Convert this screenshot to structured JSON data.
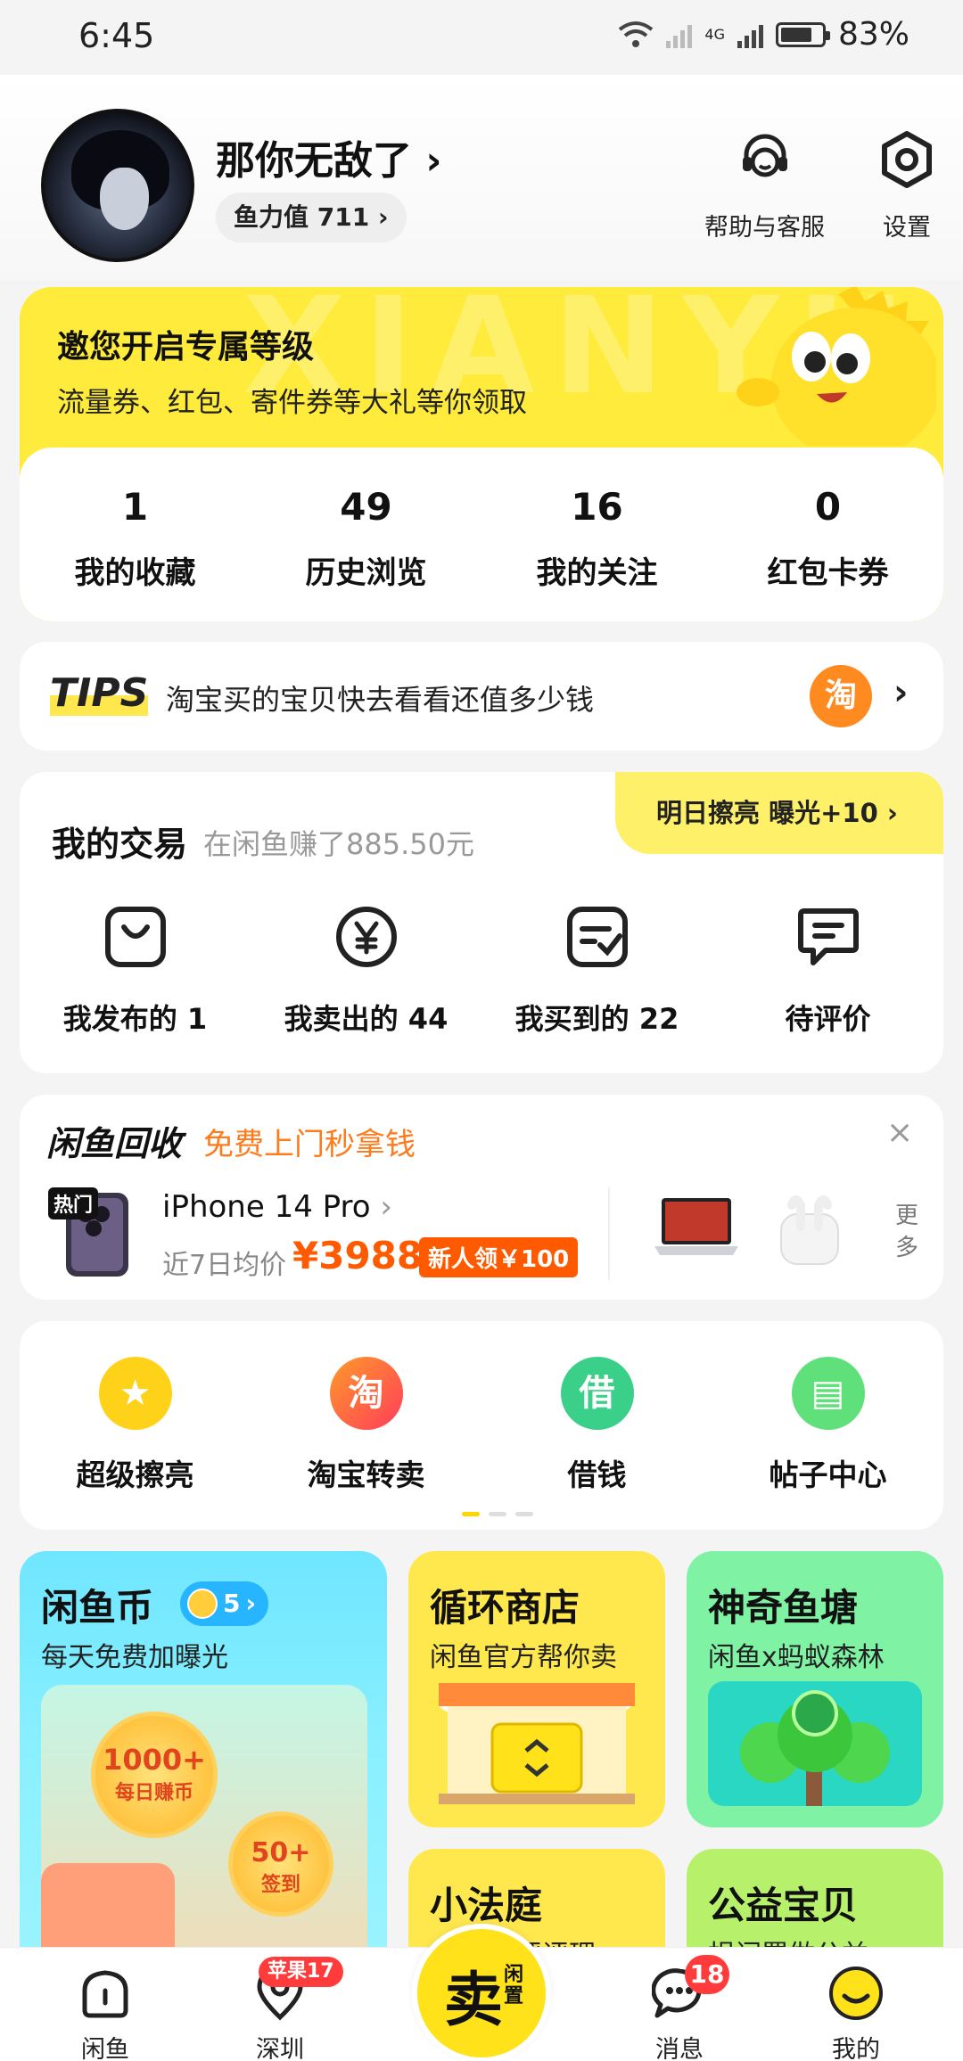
{
  "status_bar": {
    "time": "6:45",
    "battery": "83%",
    "network": "4G"
  },
  "profile": {
    "name": "那你无敌了",
    "fish_power": "鱼力值 711"
  },
  "header_actions": [
    {
      "label": "帮助与客服",
      "icon": "headset-icon"
    },
    {
      "label": "设置",
      "icon": "gear-icon"
    }
  ],
  "level_card": {
    "title": "邀您开启专属等级",
    "subtitle": "流量券、红包、寄件券等大礼等你领取",
    "bg_text": "XIANYU",
    "stats": [
      {
        "value": "1",
        "label": "我的收藏"
      },
      {
        "value": "49",
        "label": "历史浏览"
      },
      {
        "value": "16",
        "label": "我的关注"
      },
      {
        "value": "0",
        "label": "红包卡券"
      }
    ]
  },
  "tips": {
    "logo": "TIPS",
    "text": "淘宝买的宝贝快去看看还值多少钱",
    "tao_label": "淘"
  },
  "trade": {
    "title": "我的交易",
    "subtitle": "在闲鱼赚了885.50元",
    "promo": "明日擦亮 曝光+10",
    "items": [
      {
        "label": "我发布的 1",
        "icon": "bag-icon"
      },
      {
        "label": "我卖出的 44",
        "icon": "yen-icon"
      },
      {
        "label": "我买到的 22",
        "icon": "checklist-icon"
      },
      {
        "label": "待评价",
        "icon": "comment-icon"
      }
    ]
  },
  "recycle": {
    "brand": "闲鱼回收",
    "slogan": "免费上门秒拿钱",
    "close": "×",
    "hot": "热门",
    "product": "iPhone 14 Pro",
    "avg_label": "近7日均价",
    "price": "¥3988",
    "badge": "新人领￥100",
    "more": "更多"
  },
  "shortcuts": [
    {
      "label": "超级擦亮",
      "glyph": "★",
      "color": "#ffd21a"
    },
    {
      "label": "淘宝转卖",
      "glyph": "淘",
      "color": "#ff6a2a"
    },
    {
      "label": "借钱",
      "glyph": "借",
      "color": "#3bd08a"
    },
    {
      "label": "帖子中心",
      "glyph": "▤",
      "color": "#5fe07a"
    }
  ],
  "tiles": {
    "coin": {
      "title": "闲鱼币",
      "count": "5",
      "subtitle": "每天免费加曝光",
      "coin1_top": "1000+",
      "coin1_bottom": "每日赚币",
      "coin2_top": "50+",
      "coin2_bottom": "签到"
    },
    "shop": {
      "title": "循环商店",
      "subtitle": "闲鱼官方帮你卖"
    },
    "pond": {
      "title": "神奇鱼塘",
      "subtitle": "闲鱼x蚂蚁森林"
    },
    "court": {
      "title": "小法庭",
      "subtitle": "评评理"
    },
    "charity": {
      "title": "公益宝贝",
      "subtitle": "捐闲置做公益"
    }
  },
  "nav": {
    "home": "闲鱼",
    "city": "深圳",
    "city_badge": "苹果17",
    "sell_big": "卖",
    "sell_small": "闲置",
    "messages": "消息",
    "messages_badge": "18",
    "mine": "我的"
  }
}
